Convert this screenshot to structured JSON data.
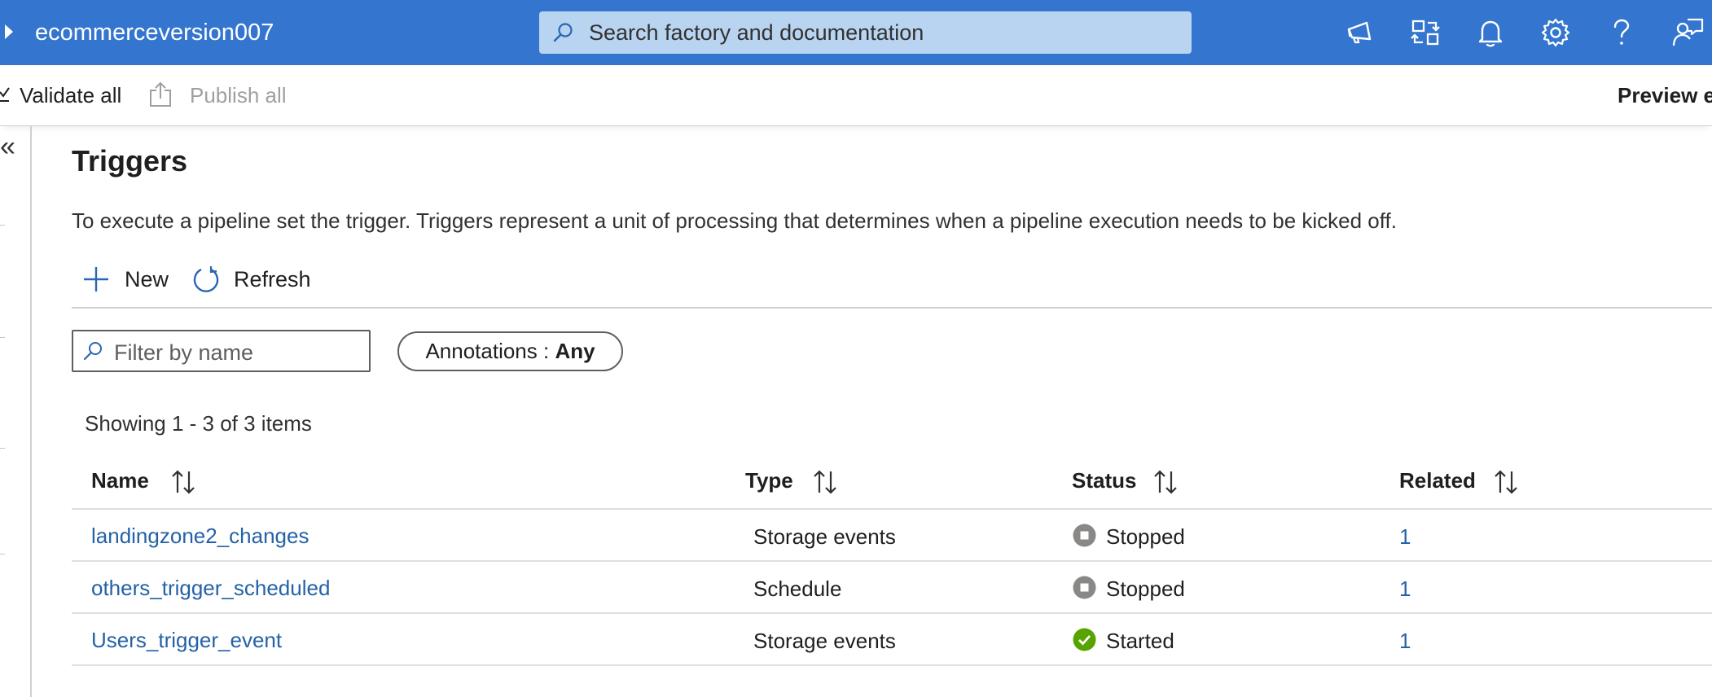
{
  "header": {
    "factory_name": "ecommerceversion007",
    "search_placeholder": "Search factory and documentation",
    "icons": [
      "megaphone-icon",
      "switch-directory-icon",
      "bell-icon",
      "gear-icon",
      "help-icon",
      "feedback-icon"
    ]
  },
  "commandbar": {
    "validate_label": "Validate all",
    "publish_label": "Publish all",
    "preview_label": "Preview ex"
  },
  "page": {
    "title": "Triggers",
    "description": "To execute a pipeline set the trigger. Triggers represent a unit of processing that determines when a pipeline execution needs to be kicked off.",
    "new_label": "New",
    "refresh_label": "Refresh",
    "filter_placeholder": "Filter by name",
    "annotations_label": "Annotations : ",
    "annotations_value": "Any",
    "showing_text": "Showing 1 - 3 of 3 items"
  },
  "table": {
    "columns": [
      "Name",
      "Type",
      "Status",
      "Related"
    ],
    "rows": [
      {
        "name": "landingzone2_changes",
        "type": "Storage events",
        "status": "Stopped",
        "related": "1"
      },
      {
        "name": "others_trigger_scheduled",
        "type": "Schedule",
        "status": "Stopped",
        "related": "1"
      },
      {
        "name": "Users_trigger_event",
        "type": "Storage events",
        "status": "Started",
        "related": "1"
      }
    ]
  },
  "colors": {
    "header_bg": "#3476cf",
    "search_bg": "#b8d4f1",
    "link": "#2462a7",
    "stopped": "#8a8886",
    "started": "#57a300"
  }
}
